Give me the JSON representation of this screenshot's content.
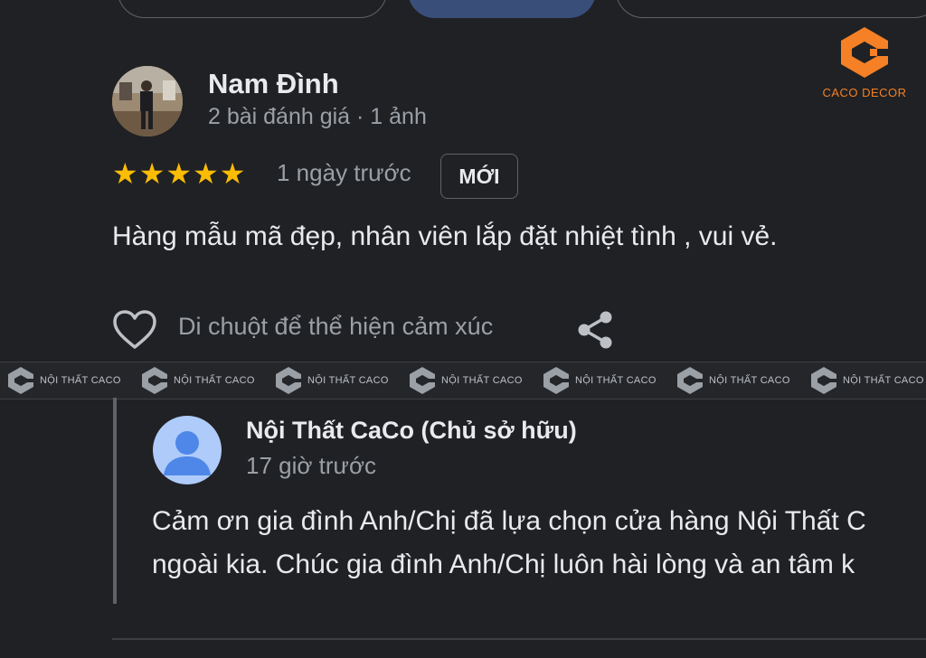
{
  "brand": {
    "logo_text": "CACO DECOR",
    "accent_color": "#f58025"
  },
  "review": {
    "reviewer_name": "Nam Đình",
    "reviewer_meta": "2 bài đánh giá · 1 ảnh",
    "rating": 5,
    "rating_max": 5,
    "star_color": "#fbbc04",
    "time": "1 ngày trước",
    "new_badge": "MỚI",
    "text": "Hàng mẫu mã đẹp, nhân viên lắp đặt nhiệt tình , vui vẻ.",
    "reaction_prompt": "Di chuột để thể hiện cảm xúc",
    "icons": [
      "heart-icon",
      "share-icon"
    ]
  },
  "watermark": {
    "text": "NỘI THẤT CACO"
  },
  "owner_reply": {
    "name": "Nội Thất CaCo (Chủ sở hữu)",
    "time": "17 giờ trước",
    "line1": "Cảm ơn gia đình Anh/Chị đã lựa chọn cửa hàng Nội Thất C",
    "line2": "ngoài kia. Chúc gia đình Anh/Chị luôn hài lòng và an tâm k"
  }
}
